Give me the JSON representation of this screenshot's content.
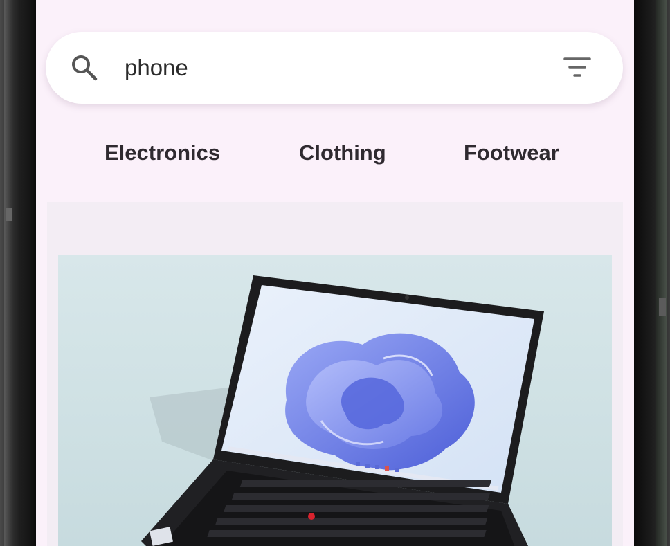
{
  "search": {
    "query": "phone",
    "icon": "search-icon",
    "filter_icon": "filter-icon"
  },
  "categories": [
    {
      "label": "Electronics"
    },
    {
      "label": "Clothing"
    },
    {
      "label": "Footwear"
    }
  ],
  "product": {
    "image": "laptop-image"
  },
  "colors": {
    "screen_background": "#fbf1fa",
    "card_background": "#f3edf4",
    "search_background": "#ffffff",
    "text": "#2f2a30"
  }
}
